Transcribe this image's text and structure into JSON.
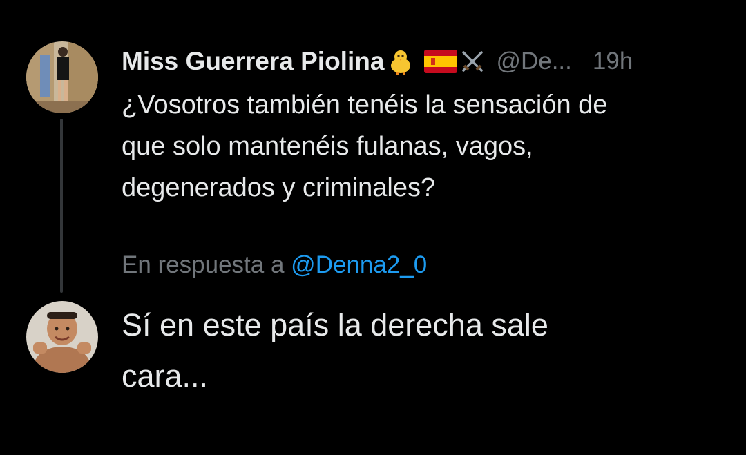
{
  "tweet": {
    "display_name": "Miss Guerrera Piolina",
    "emoji_icons": [
      "baby-chick-icon",
      "spain-flag-icon",
      "crossed-swords-icon"
    ],
    "handle": "@De...",
    "timestamp": "19h",
    "text_lines": [
      "¿Vosotros también tenéis la sensación de",
      "que solo mantenéis fulanas, vagos,",
      "degenerados y criminales?"
    ]
  },
  "reply": {
    "in_reply_prefix": "En respuesta a",
    "in_reply_mention": "@Denna2_0",
    "text_lines": [
      "Sí  en este país la derecha sale",
      "cara..."
    ]
  },
  "colors": {
    "background": "#000000",
    "primary_text": "#e7e9ea",
    "secondary_text": "#71767b",
    "mention": "#1d9bf0",
    "thread_line": "#333639"
  }
}
